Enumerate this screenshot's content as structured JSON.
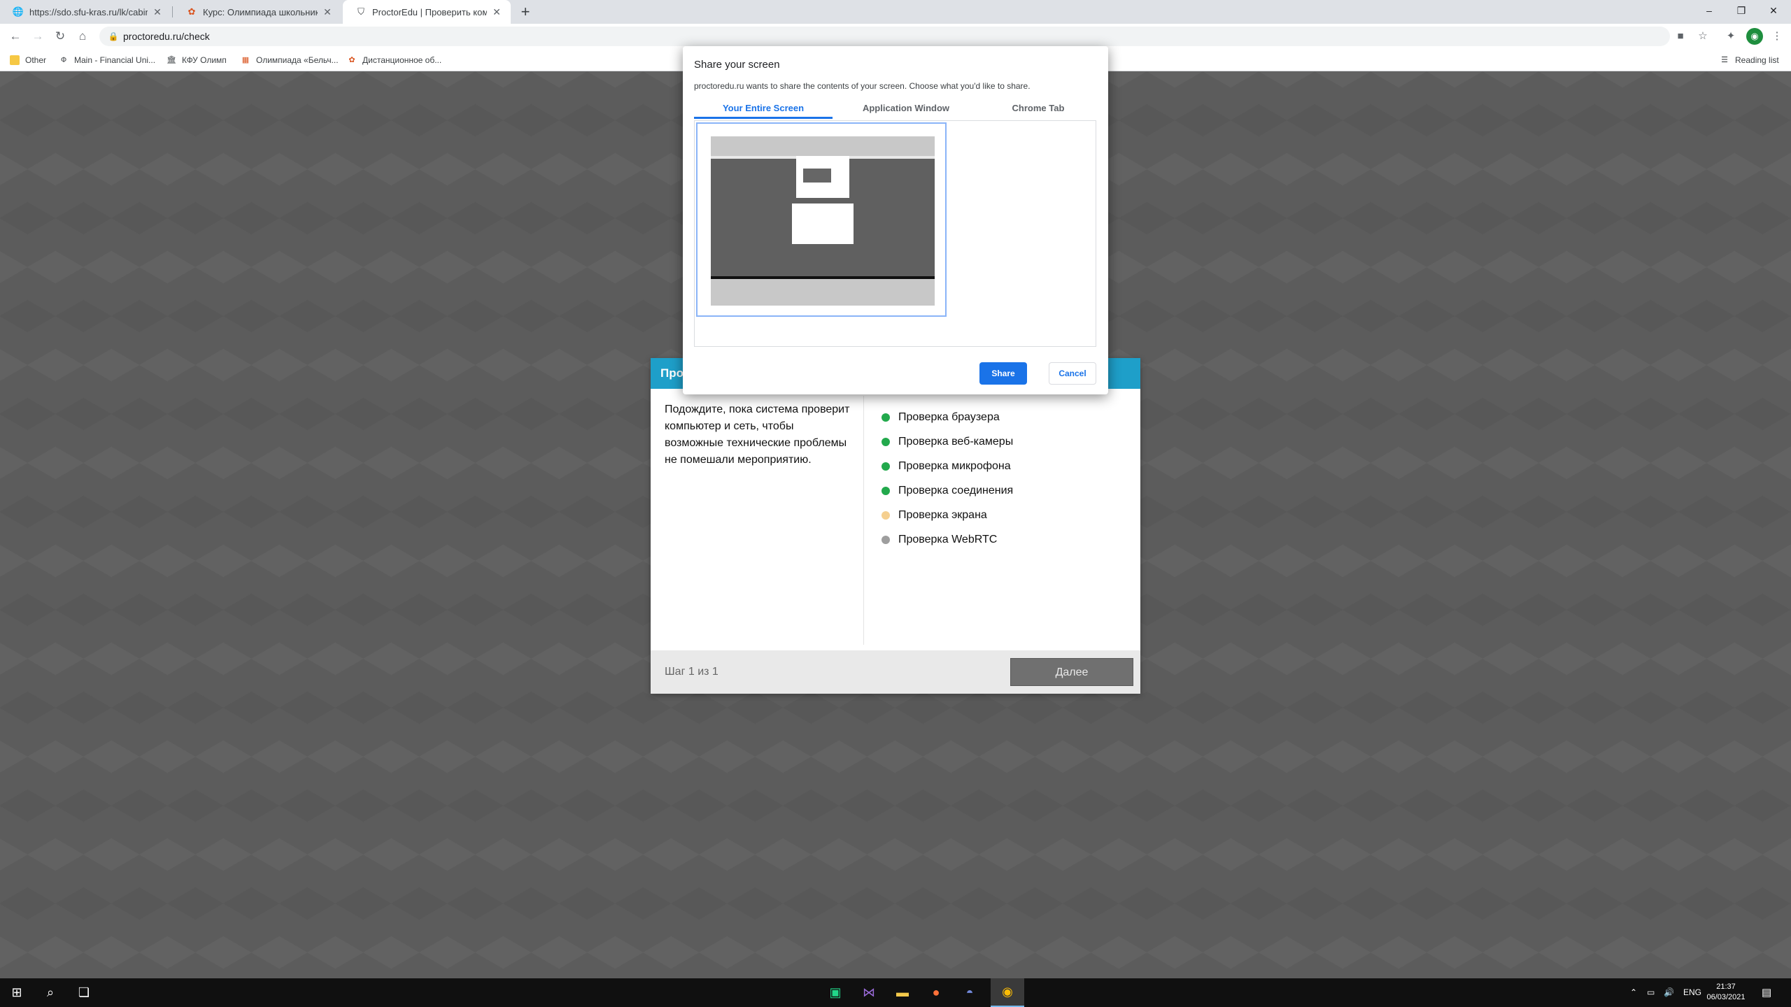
{
  "browser": {
    "tabs": [
      {
        "title": "https://sdo.sfu-kras.ru/lk/cabinet",
        "icon": "globe-icon"
      },
      {
        "title": "Курс: Олимпиада школьников",
        "icon": "olymp-icon"
      },
      {
        "title": "ProctorEdu | Проверить компь",
        "icon": "shield-icon"
      }
    ],
    "new_tab": "+",
    "window_controls": {
      "minimize": "–",
      "restore": "❐",
      "close": "✕"
    },
    "url": "proctoredu.ru/check",
    "bookmarks": [
      {
        "label": "Other",
        "icon": "folder-icon"
      },
      {
        "label": "Main - Financial Uni...",
        "icon": "fu-icon"
      },
      {
        "label": "КФУ Олимп",
        "icon": "kfu-icon"
      },
      {
        "label": "Олимпиада «Бельч...",
        "icon": "belch-icon"
      },
      {
        "label": "Дистанционное об...",
        "icon": "distance-icon"
      }
    ],
    "reading_list": "Reading list"
  },
  "card": {
    "header": "Про",
    "description": "Подождите, пока система проверит компьютер и сеть, чтобы возможные технические проблемы не помешали мероприятию.",
    "checks": [
      {
        "label": "Проверка браузера",
        "status": "done",
        "color": "#22a94c"
      },
      {
        "label": "Проверка веб-камеры",
        "status": "done",
        "color": "#22a94c"
      },
      {
        "label": "Проверка микрофона",
        "status": "done",
        "color": "#22a94c"
      },
      {
        "label": "Проверка соединения",
        "status": "done",
        "color": "#22a94c"
      },
      {
        "label": "Проверка экрана",
        "status": "pending",
        "color": "#f5cf8f"
      },
      {
        "label": "Проверка WebRTC",
        "status": "waiting",
        "color": "#9e9e9e"
      }
    ],
    "step": "Шаг 1 из 1",
    "next_label": "Далее"
  },
  "share_dialog": {
    "title": "Share your screen",
    "subtitle": "proctoredu.ru wants to share the contents of your screen. Choose what you'd like to share.",
    "tabs": [
      "Your Entire Screen",
      "Application Window",
      "Chrome Tab"
    ],
    "active_tab": "Your Entire Screen",
    "share_label": "Share",
    "cancel_label": "Cancel"
  },
  "taskbar": {
    "apps": [
      "start-icon",
      "search-icon",
      "task-view-icon",
      "pycharm-icon",
      "visual-studio-icon",
      "file-explorer-icon",
      "firefox-icon",
      "discord-icon",
      "chrome-icon"
    ],
    "language": "ENG",
    "time": "21:37",
    "date": "06/03/2021"
  },
  "colors": {
    "accent_blue": "#1a73e8",
    "card_header": "#1e9fc9",
    "ok_green": "#22a94c"
  }
}
